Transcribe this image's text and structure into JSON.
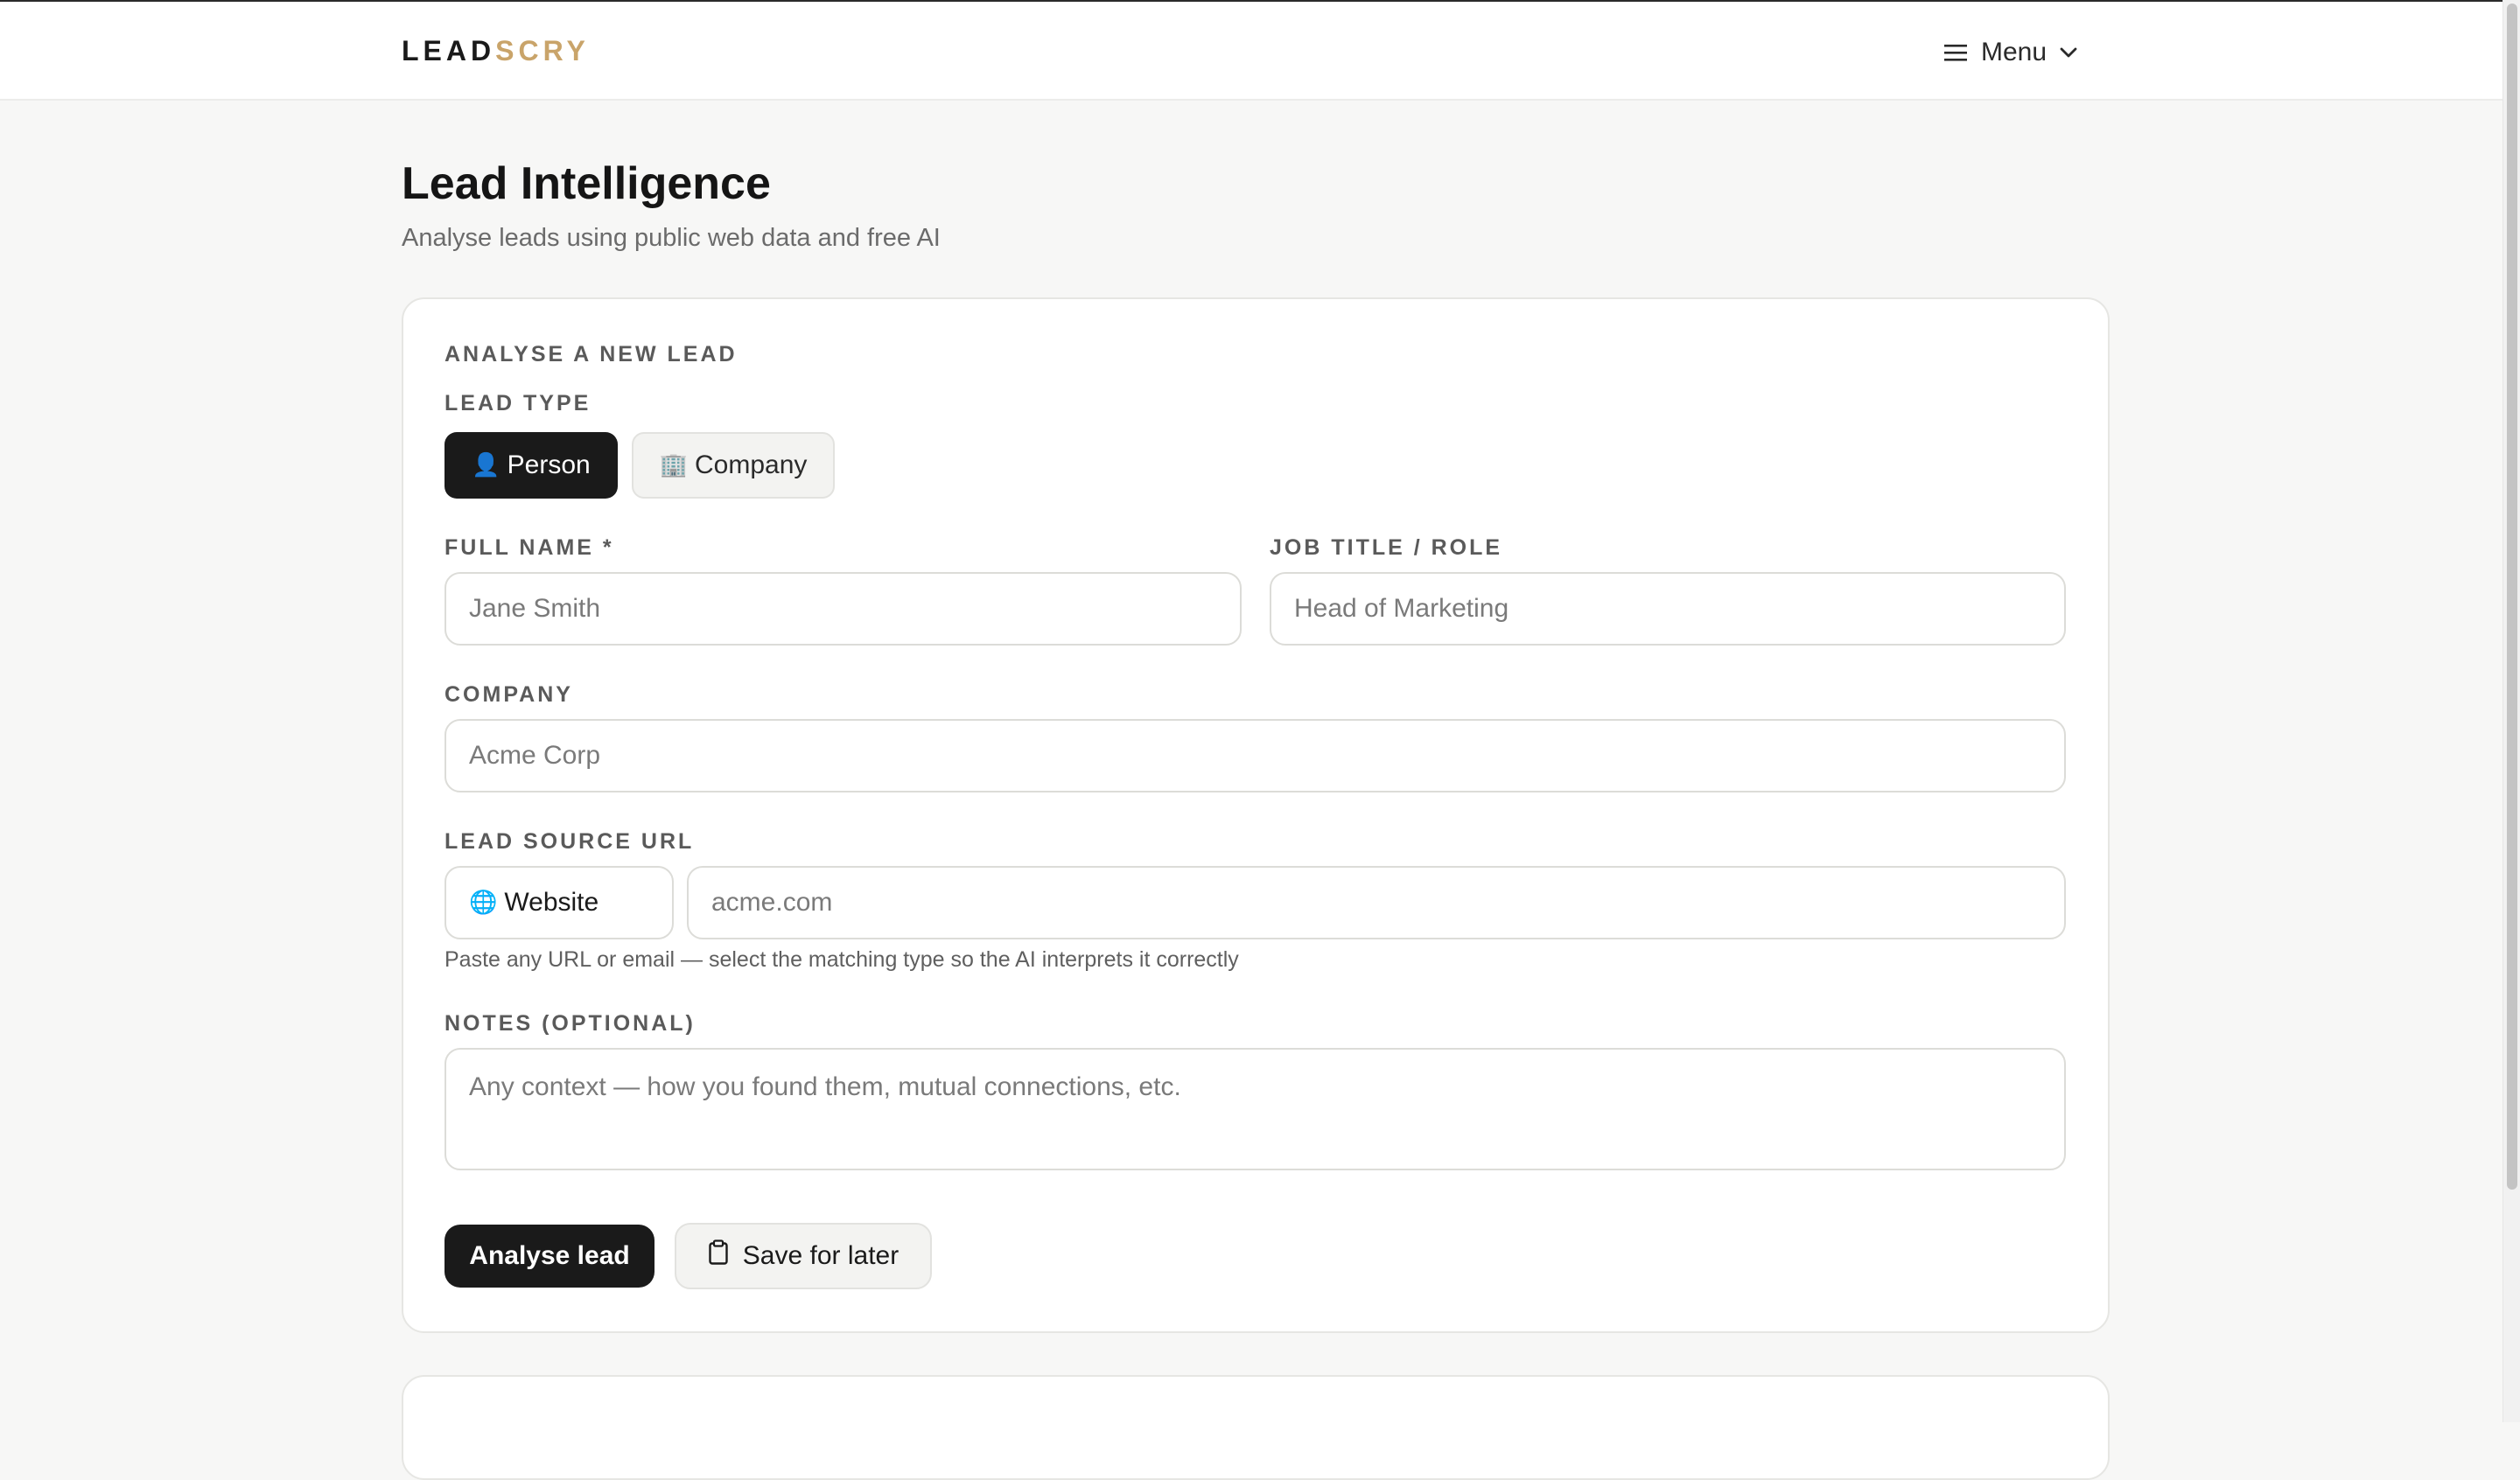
{
  "header": {
    "logo_part1": "LEAD",
    "logo_part2": "SCRY",
    "menu_label": "Menu"
  },
  "page": {
    "title": "Lead Intelligence",
    "subtitle": "Analyse leads using public web data and free AI"
  },
  "form": {
    "section_title": "ANALYSE A NEW LEAD",
    "lead_type_label": "LEAD TYPE",
    "lead_types": [
      {
        "icon": "👤",
        "label": "Person",
        "active": true
      },
      {
        "icon": "🏢",
        "label": "Company",
        "active": false
      }
    ],
    "full_name": {
      "label": "FULL NAME *",
      "placeholder": "Jane Smith",
      "value": ""
    },
    "job_title": {
      "label": "JOB TITLE / ROLE",
      "placeholder": "Head of Marketing",
      "value": ""
    },
    "company": {
      "label": "COMPANY",
      "placeholder": "Acme Corp",
      "value": ""
    },
    "source_url": {
      "label": "LEAD SOURCE URL",
      "type_icon": "🌐",
      "type_selected": "Website",
      "placeholder": "acme.com",
      "hint": "Paste any URL or email — select the matching type so the AI interprets it correctly"
    },
    "notes": {
      "label": "NOTES (OPTIONAL)",
      "placeholder": "Any context — how you found them, mutual connections, etc."
    },
    "analyse_button": "Analyse lead",
    "save_button": "Save for later"
  },
  "colors": {
    "accent_gold": "#c9a46a",
    "primary_dark": "#1a1a1a",
    "background": "#f7f7f6"
  }
}
